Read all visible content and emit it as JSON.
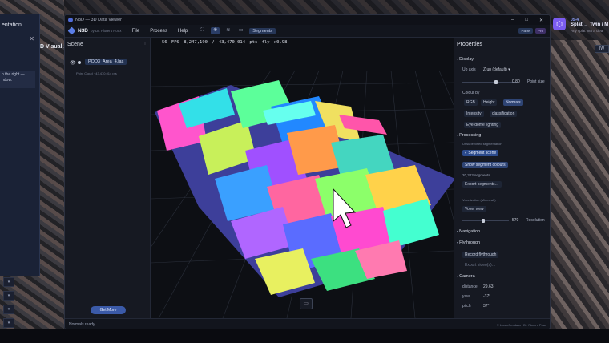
{
  "desktop": {
    "left_panel": {
      "title": "entation",
      "box_text": "n the right — ndow.",
      "mini_items": [
        "",
        "",
        "",
        "",
        "",
        ""
      ],
      "visual_label": "D Visualiz",
      "dock_buttons": [
        "▾",
        "▾",
        "▾",
        "▾",
        "▾"
      ]
    },
    "notification": {
      "tag": "05-4",
      "title": "Splat → Twin / M",
      "subtitle": "Any splat into a clear"
    },
    "right_button": "IW"
  },
  "window": {
    "title": "N3D — 3D Data Viewer",
    "controls": [
      "–",
      "□",
      "✕"
    ],
    "app_name": "N3D",
    "app_by": "by Dr. Florent Poux",
    "menu": [
      "File",
      "Process",
      "Help"
    ],
    "tools": [
      "⛶",
      "⁜",
      "≋",
      "▭"
    ],
    "segments_pill": "Segments",
    "right_pills": [
      "Panel",
      "Pro"
    ]
  },
  "scene": {
    "title": "Scene",
    "more": "⋮",
    "file_name": "POD3_Area_4.las",
    "file_info": "Point Cloud · 43,470,014 pts",
    "get_more": "Get More"
  },
  "viewport": {
    "fps": "56 FPS",
    "points": "8,247,190 / 43,470,014 pts",
    "mode": "fly x0.98",
    "bottom_button": "▭"
  },
  "properties": {
    "title": "Properties",
    "display": {
      "section": "Display",
      "up_axis_label": "Up axis",
      "up_axis_value": "Z up (default)",
      "point_size_value": "0.80",
      "point_size_label": "Point size",
      "point_size_fraction": 0.6,
      "colour_by_label": "Colour by",
      "colour_options": [
        "RGB",
        "Height",
        "Normals"
      ],
      "colour_selected": "Normals",
      "colour_options_2": [
        "Intensity",
        "classification"
      ],
      "eye_dome": "Eye-dome lighting"
    },
    "processing": {
      "section": "Processing",
      "sub": "Unsupervised segmentation",
      "segment_scene": "◐ Segment scene",
      "show_colours": "Show segment colours",
      "segments_count": "20,323 segments",
      "export": "Export segments…",
      "voxel_sub": "Voxelization (Minecraft)",
      "voxel_view": "Voxel view",
      "resolution_value": "570",
      "resolution_label": "Resolution",
      "resolution_fraction": 0.45
    },
    "navigation": {
      "section": "Navigation"
    },
    "flythrough": {
      "section": "Flythrough",
      "record": "Record flythrough",
      "export_video": "Export video(s)…"
    },
    "camera": {
      "section": "Camera",
      "rows": [
        {
          "label": "distance",
          "value": "29.63"
        },
        {
          "label": "yaw",
          "value": "-37°"
        },
        {
          "label": "pitch",
          "value": "37°"
        }
      ]
    }
  },
  "statusbar": {
    "left": "Normals ready",
    "right": "© LearnGeodata · Dr. Florent Poux"
  }
}
